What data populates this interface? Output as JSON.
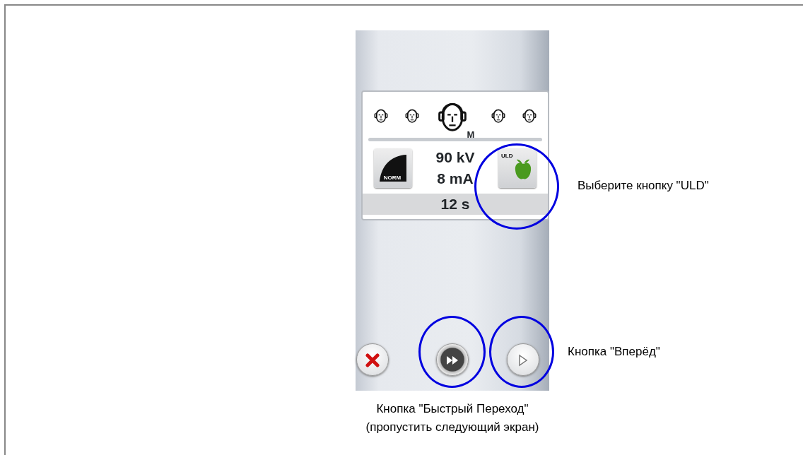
{
  "screen": {
    "heads": [
      {
        "selected": false
      },
      {
        "selected": false
      },
      {
        "selected": true
      },
      {
        "selected": false
      },
      {
        "selected": false
      }
    ],
    "size_label": "M",
    "modes": [
      {
        "kind": "norm",
        "label": "NORM"
      },
      {
        "kind": "uld",
        "label": "ULD"
      }
    ],
    "kv": "90 kV",
    "ma": "8 mA",
    "time": "12 s",
    "buttons": [
      {
        "kind": "cancel"
      },
      {
        "kind": "fast-forward"
      },
      {
        "kind": "next"
      }
    ]
  },
  "callouts": [
    {
      "kind": "uld",
      "text": "Выберите кнопку \"ULD\""
    },
    {
      "kind": "next",
      "text": "Кнопка \"Вперёд\""
    },
    {
      "kind": "fast-forward",
      "text": "Кнопка \"Быстрый Переход\"",
      "note": "(пропустить следующий экран)"
    }
  ]
}
